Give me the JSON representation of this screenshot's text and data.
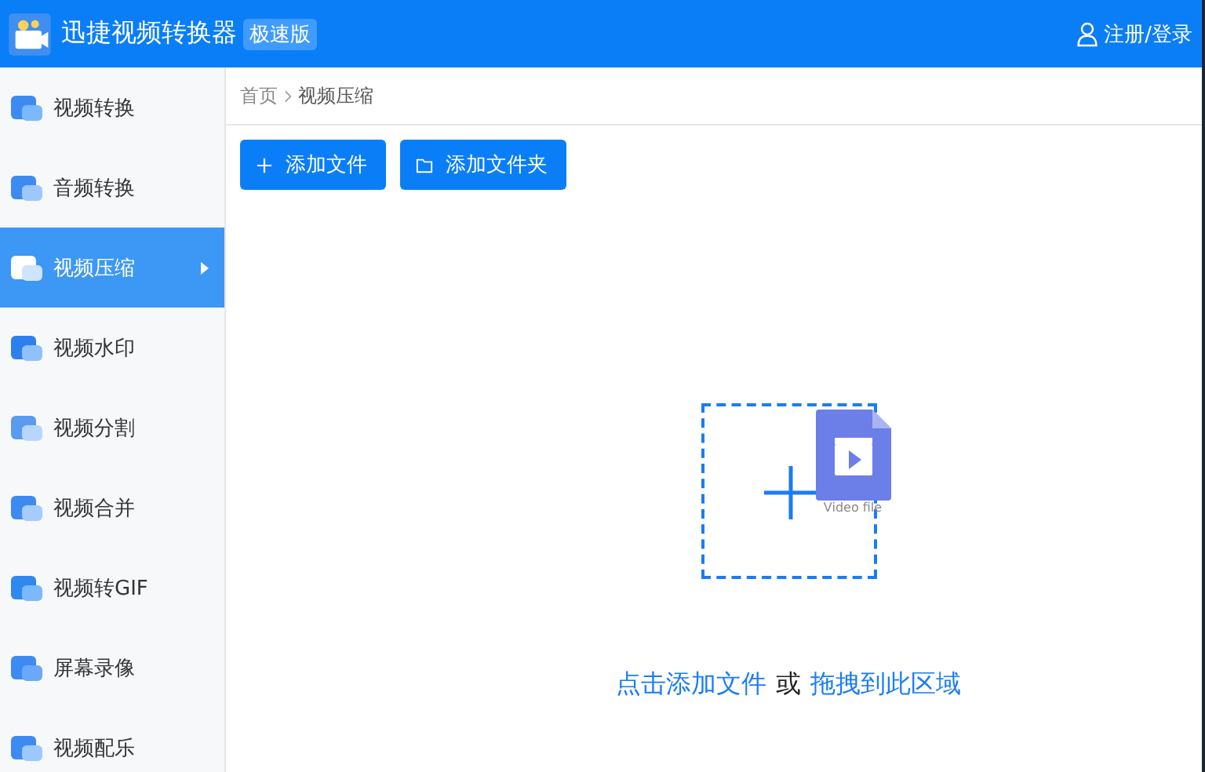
{
  "window": {
    "title": "迅捷视频转换器",
    "badge": "极速版"
  },
  "account": {
    "label": "注册/登录"
  },
  "sidebar": {
    "items": [
      {
        "label": "视频转换",
        "selected": false
      },
      {
        "label": "音频转换",
        "selected": false
      },
      {
        "label": "视频压缩",
        "selected": true
      },
      {
        "label": "视频水印",
        "selected": false
      },
      {
        "label": "视频分割",
        "selected": false
      },
      {
        "label": "视频合并",
        "selected": false
      },
      {
        "label": "视频转GIF",
        "selected": false
      },
      {
        "label": "屏幕录像",
        "selected": false
      },
      {
        "label": "视频配乐",
        "selected": false
      }
    ]
  },
  "breadcrumb": [
    "首页",
    "视频压缩"
  ],
  "toolbar": [
    {
      "kind": "file",
      "label": "添加文件"
    },
    {
      "kind": "folder",
      "label": "添加文件夹"
    }
  ],
  "dropzone": {
    "file_caption": "Video file",
    "hint": [
      {
        "kind": "link",
        "text": "点击添加文件"
      },
      {
        "kind": "plain",
        "text": "或"
      },
      {
        "kind": "link",
        "text": "拖拽到此区域"
      }
    ]
  }
}
